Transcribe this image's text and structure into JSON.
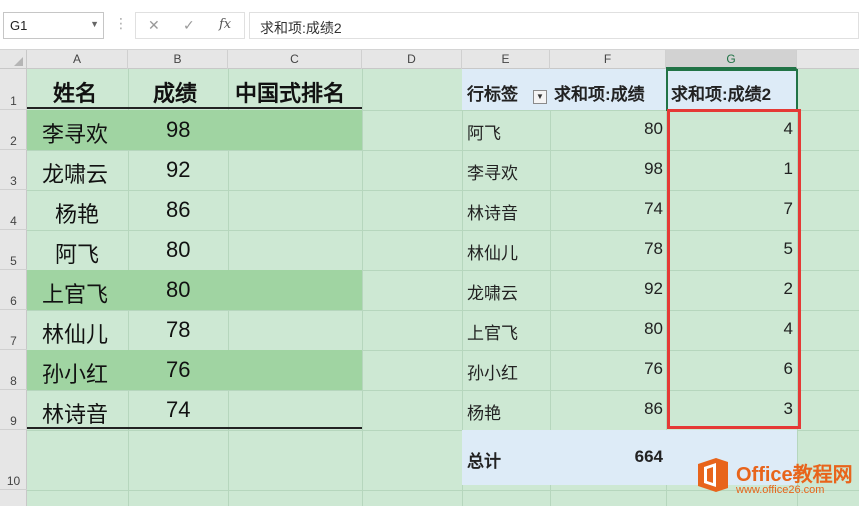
{
  "formula_bar": {
    "name_box": "G1",
    "cancel_icon": "✕",
    "enter_icon": "✓",
    "fx_label": "fx",
    "formula": "求和项:成绩2"
  },
  "columns": [
    "A",
    "B",
    "C",
    "D",
    "E",
    "F",
    "G"
  ],
  "rows": [
    "1",
    "2",
    "3",
    "4",
    "5",
    "6",
    "7",
    "8",
    "9",
    "10"
  ],
  "left_table": {
    "headers": [
      "姓名",
      "成绩",
      "中国式排名"
    ],
    "rows": [
      {
        "name": "李寻欢",
        "score": "98"
      },
      {
        "name": "龙啸云",
        "score": "92"
      },
      {
        "name": "杨艳",
        "score": "86"
      },
      {
        "name": "阿飞",
        "score": "80"
      },
      {
        "name": "上官飞",
        "score": "80"
      },
      {
        "name": "林仙儿",
        "score": "78"
      },
      {
        "name": "孙小红",
        "score": "76"
      },
      {
        "name": "林诗音",
        "score": "74"
      }
    ]
  },
  "pivot": {
    "headers": [
      "行标签",
      "求和项:成绩",
      "求和项:成绩2"
    ],
    "rows": [
      {
        "label": "阿飞",
        "sum": "80",
        "rank": "4"
      },
      {
        "label": "李寻欢",
        "sum": "98",
        "rank": "1"
      },
      {
        "label": "林诗音",
        "sum": "74",
        "rank": "7"
      },
      {
        "label": "林仙儿",
        "sum": "78",
        "rank": "5"
      },
      {
        "label": "龙啸云",
        "sum": "92",
        "rank": "2"
      },
      {
        "label": "上官飞",
        "sum": "80",
        "rank": "4"
      },
      {
        "label": "孙小红",
        "sum": "76",
        "rank": "6"
      },
      {
        "label": "杨艳",
        "sum": "86",
        "rank": "3"
      }
    ],
    "total_label": "总计",
    "total_value": "664"
  },
  "watermark": {
    "title": "Office教程网",
    "url": "www.office26.com"
  },
  "colors": {
    "sheet_bg": "#cde8d3",
    "band": "#a0d4a2",
    "pivot_header": "#ddebf7",
    "selection": "#217346",
    "highlight": "#e53935",
    "brand": "#e8641b"
  }
}
